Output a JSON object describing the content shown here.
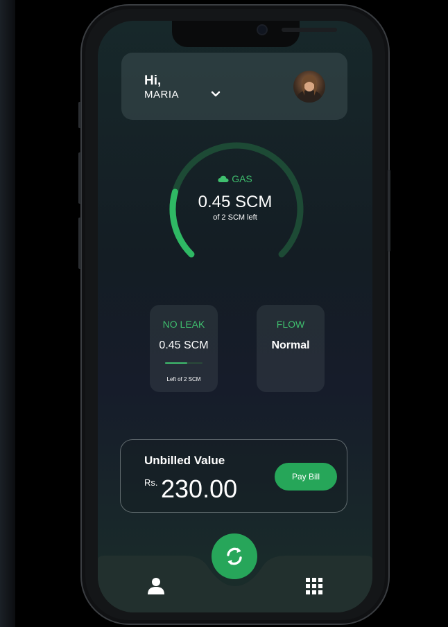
{
  "colors": {
    "accent": "#3fbf6e",
    "button": "#26a659",
    "screen_bg": "#141d24"
  },
  "header": {
    "greeting": "Hi,",
    "user_name": "MARIA",
    "dropdown_icon": "chevron-down-icon",
    "avatar_icon": "user-avatar"
  },
  "gauge": {
    "icon": "cloud-icon",
    "label": "GAS",
    "value": "0.45 SCM",
    "subtitle": "of 2 SCM left",
    "fraction": 0.225
  },
  "stats": [
    {
      "title": "NO LEAK",
      "value": "0.45 SCM",
      "progress": 0.6,
      "footnote": "Left of 2 SCM"
    },
    {
      "title": "FLOW",
      "value": "Normal"
    }
  ],
  "bill": {
    "title": "Unbilled Value",
    "currency": "Rs.",
    "amount": "230.00",
    "pay_label": "Pay Bill"
  },
  "nav": {
    "left_icon": "user-icon",
    "center_icon": "refresh-icon",
    "right_icon": "grid-icon"
  }
}
